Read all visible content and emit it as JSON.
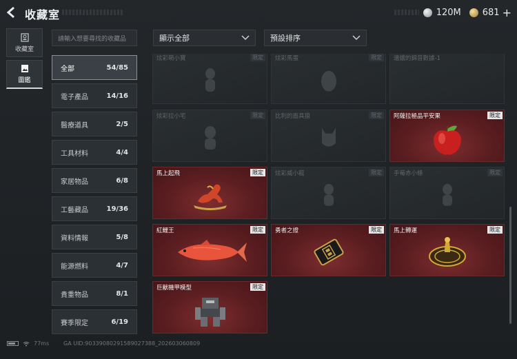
{
  "header": {
    "title": "收藏室",
    "currency": [
      {
        "icon": "silver-coin-icon",
        "value": "120M"
      },
      {
        "icon": "gold-coin-icon",
        "value": "681"
      }
    ]
  },
  "side_tabs": [
    {
      "label": "收藏室",
      "icon": "collection-room-icon",
      "active": false
    },
    {
      "label": "圖鑑",
      "icon": "gallery-icon",
      "active": true
    }
  ],
  "search": {
    "placeholder": "請輸入想要尋找的收藏品"
  },
  "categories": [
    {
      "label": "全部",
      "count": "54/85",
      "active": true
    },
    {
      "label": "電子產品",
      "count": "14/16"
    },
    {
      "label": "醫療道具",
      "count": "2/5"
    },
    {
      "label": "工具材料",
      "count": "4/4"
    },
    {
      "label": "家居物品",
      "count": "6/8"
    },
    {
      "label": "工藝藏品",
      "count": "19/36"
    },
    {
      "label": "資料情報",
      "count": "5/8"
    },
    {
      "label": "能源燃料",
      "count": "4/7"
    },
    {
      "label": "貴重物品",
      "count": "8/1"
    },
    {
      "label": "賽季限定",
      "count": "6/19"
    }
  ],
  "filters": {
    "display": "顯示全部",
    "sort": "預設排序"
  },
  "items": [
    {
      "name": "炫彩萌小寶",
      "tag": "限定",
      "owned": false
    },
    {
      "name": "炫彩馬蛋",
      "tag": "限定",
      "owned": false
    },
    {
      "name": "遺娥的錦音數據-1",
      "tag": "",
      "owned": false
    },
    {
      "name": "炫彩拉小宅",
      "tag": "限定",
      "owned": false
    },
    {
      "name": "比利的面具狼",
      "tag": "限定",
      "owned": false
    },
    {
      "name": "阿薩拉極品平安果",
      "tag": "限定",
      "owned": true
    },
    {
      "name": "馬上起飛",
      "tag": "限定",
      "owned": true
    },
    {
      "name": "炫彩威小龍",
      "tag": "限定",
      "owned": false
    },
    {
      "name": "手莓赤小條",
      "tag": "限定",
      "owned": false
    },
    {
      "name": "紅鯉王",
      "tag": "限定",
      "owned": true
    },
    {
      "name": "勇者之證",
      "tag": "限定",
      "owned": true
    },
    {
      "name": "馬上轉運",
      "tag": "限定",
      "owned": true
    },
    {
      "name": "巨獸機甲模型",
      "tag": "限定",
      "owned": true
    }
  ],
  "status": {
    "ping": "77ms",
    "uid": "GA UID:903390802915890273​88_202603060809"
  },
  "colors": {
    "owned_card": "#5a1d20",
    "locked_card": "#2a2f32",
    "accent": "#d8dadc"
  }
}
